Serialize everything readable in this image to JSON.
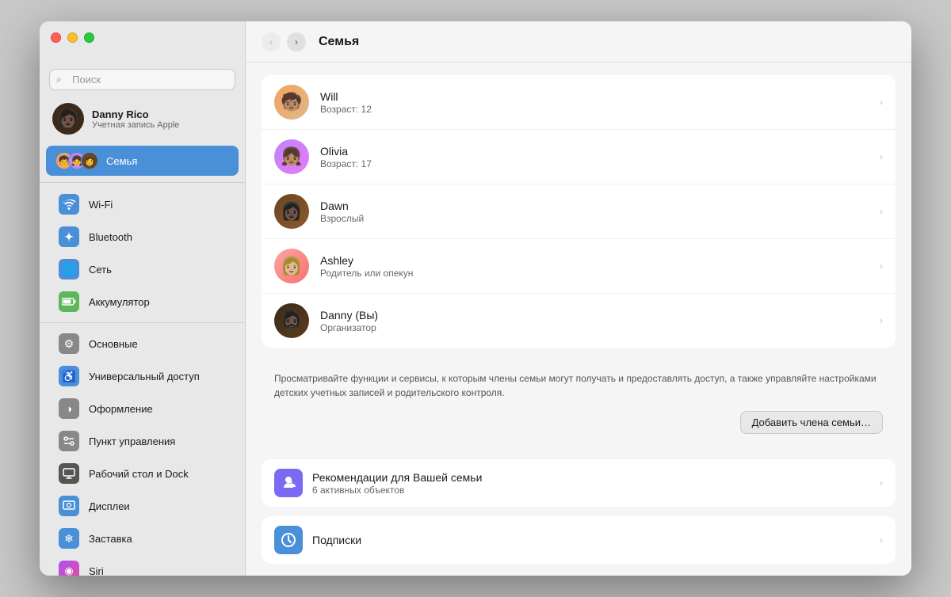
{
  "window": {
    "title": "Семья"
  },
  "trafficLights": {
    "close": "close",
    "minimize": "minimize",
    "maximize": "maximize"
  },
  "sidebar": {
    "search": {
      "placeholder": "Поиск"
    },
    "user": {
      "name": "Danny Rico",
      "subtitle": "Учетная запись Apple",
      "avatar_emoji": "🧑🏿"
    },
    "family_item": {
      "label": "Семья"
    },
    "items": [
      {
        "id": "wifi",
        "label": "Wi-Fi",
        "icon": "wifi",
        "icon_char": "📶"
      },
      {
        "id": "bluetooth",
        "label": "Bluetooth",
        "icon": "bluetooth",
        "icon_char": "✦"
      },
      {
        "id": "network",
        "label": "Сеть",
        "icon": "network",
        "icon_char": "🌐"
      },
      {
        "id": "battery",
        "label": "Аккумулятор",
        "icon": "battery",
        "icon_char": "🔋"
      },
      {
        "id": "general",
        "label": "Основные",
        "icon": "general",
        "icon_char": "⚙"
      },
      {
        "id": "accessibility",
        "label": "Универсальный доступ",
        "icon": "accessibility",
        "icon_char": "♿"
      },
      {
        "id": "appearance",
        "label": "Оформление",
        "icon": "appearance",
        "icon_char": "●"
      },
      {
        "id": "control",
        "label": "Пункт управления",
        "icon": "control",
        "icon_char": "▦"
      },
      {
        "id": "desktop",
        "label": "Рабочий стол и Dock",
        "icon": "desktop",
        "icon_char": "▭"
      },
      {
        "id": "displays",
        "label": "Дисплеи",
        "icon": "displays",
        "icon_char": "✦"
      },
      {
        "id": "screensaver",
        "label": "Заставка",
        "icon": "screensaver",
        "icon_char": "❄"
      },
      {
        "id": "siri",
        "label": "Siri",
        "icon": "siri",
        "icon_char": "◉"
      }
    ]
  },
  "main": {
    "title": "Семья",
    "members": [
      {
        "name": "Will",
        "role": "Возраст: 12",
        "emoji": "🧒🏽"
      },
      {
        "name": "Olivia",
        "role": "Возраст: 17",
        "emoji": "👧🏽"
      },
      {
        "name": "Dawn",
        "role": "Взрослый",
        "emoji": "👩🏿"
      },
      {
        "name": "Ashley",
        "role": "Родитель или опекун",
        "emoji": "👩🏼"
      },
      {
        "name": "Danny (Вы)",
        "role": "Организатор",
        "emoji": "🧔🏿"
      }
    ],
    "description": "Просматривайте функции и сервисы, к которым члены семьи могут получать и предоставлять доступ, а также управляйте настройками детских учетных записей и родительского контроля.",
    "add_button": "Добавить члена семьи…",
    "features": [
      {
        "id": "recommendations",
        "name": "Рекомендации для Вашей семьи",
        "sub": "6 активных объектов",
        "icon": "👥",
        "icon_class": "feature-icon-purple"
      },
      {
        "id": "subscriptions",
        "name": "Подписки",
        "sub": "",
        "icon": "⬆",
        "icon_class": "feature-icon-blue"
      }
    ]
  }
}
